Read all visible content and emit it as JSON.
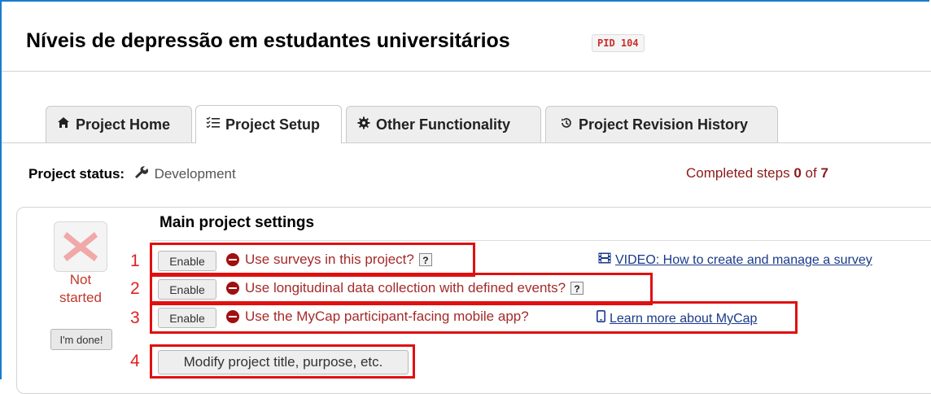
{
  "header": {
    "title": "Níveis de depressão em estudantes universitários",
    "pid": "PID 104"
  },
  "tabs": [
    {
      "label": "Project Home",
      "icon": "home-icon"
    },
    {
      "label": "Project Setup",
      "icon": "list-checks-icon",
      "active": true
    },
    {
      "label": "Other Functionality",
      "icon": "gear-icon"
    },
    {
      "label": "Project Revision History",
      "icon": "history-icon"
    }
  ],
  "status": {
    "label": "Project status:",
    "value": "Development",
    "completed_prefix": "Completed steps",
    "completed_count": "0",
    "completed_of": "of",
    "completed_total": "7"
  },
  "panel": {
    "step_state": "Not started",
    "done_label": "I'm done!",
    "section_title": "Main project settings",
    "items": [
      {
        "number": "1",
        "button": "Enable",
        "text": "Use surveys in this project?",
        "help": "?"
      },
      {
        "number": "2",
        "button": "Enable",
        "text": "Use longitudinal data collection with defined events?",
        "help": "?"
      },
      {
        "number": "3",
        "button": "Enable",
        "text": "Use the MyCap participant-facing mobile app?"
      },
      {
        "number": "4",
        "button": "Modify project title, purpose, etc."
      }
    ],
    "video_link": "VIDEO: How to create and manage a survey",
    "mycap_link": "Learn more about MyCap"
  },
  "colors": {
    "frame_blue": "#1a7ad1",
    "annotation_red": "#e01010",
    "option_text": "#a52a2a",
    "link": "#1a3a8a"
  }
}
